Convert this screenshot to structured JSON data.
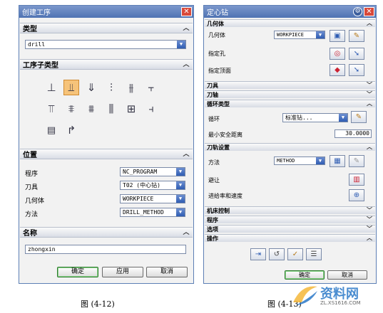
{
  "left_dialog": {
    "title": "创建工序",
    "sections": {
      "type": "类型",
      "subtype": "工序子类型",
      "location": "位置",
      "name": "名称"
    },
    "type_value": "drill",
    "location_rows": [
      {
        "label": "程序",
        "value": "NC_PROGRAM"
      },
      {
        "label": "刀具",
        "value": "T02 (中心钻)"
      },
      {
        "label": "几何体",
        "value": "WORKPIECE"
      },
      {
        "label": "方法",
        "value": "DRILL_METHOD"
      }
    ],
    "name_value": "zhongxin",
    "buttons": {
      "ok": "确定",
      "apply": "应用",
      "cancel": "取消"
    },
    "caption": "图 (4-12)"
  },
  "right_dialog": {
    "title": "定心钻",
    "geometry_section": "几何体",
    "geometry_label": "几何体",
    "geometry_value": "WORKPIECE",
    "spec_hole": "指定孔",
    "spec_top": "指定顶面",
    "tool_section": "刀具",
    "axis_section": "刀轴",
    "cycle_section": "循环类型",
    "cycle_label": "循环",
    "cycle_value": "标准钻...",
    "min_clearance_label": "最小安全距离",
    "min_clearance_value": "30.0000",
    "toolpath_section": "刀轨设置",
    "method_label": "方法",
    "method_value": "METHOD",
    "avoid_label": "避让",
    "feeds_label": "进给率和速度",
    "machine_control": "机床控制",
    "program": "程序",
    "options": "选项",
    "actions": "操作",
    "buttons": {
      "ok": "确定",
      "cancel": "取消"
    },
    "caption": "图 (4-13)"
  },
  "watermark": {
    "main": "资料网",
    "sub": "ZL.XS1616.COM"
  }
}
